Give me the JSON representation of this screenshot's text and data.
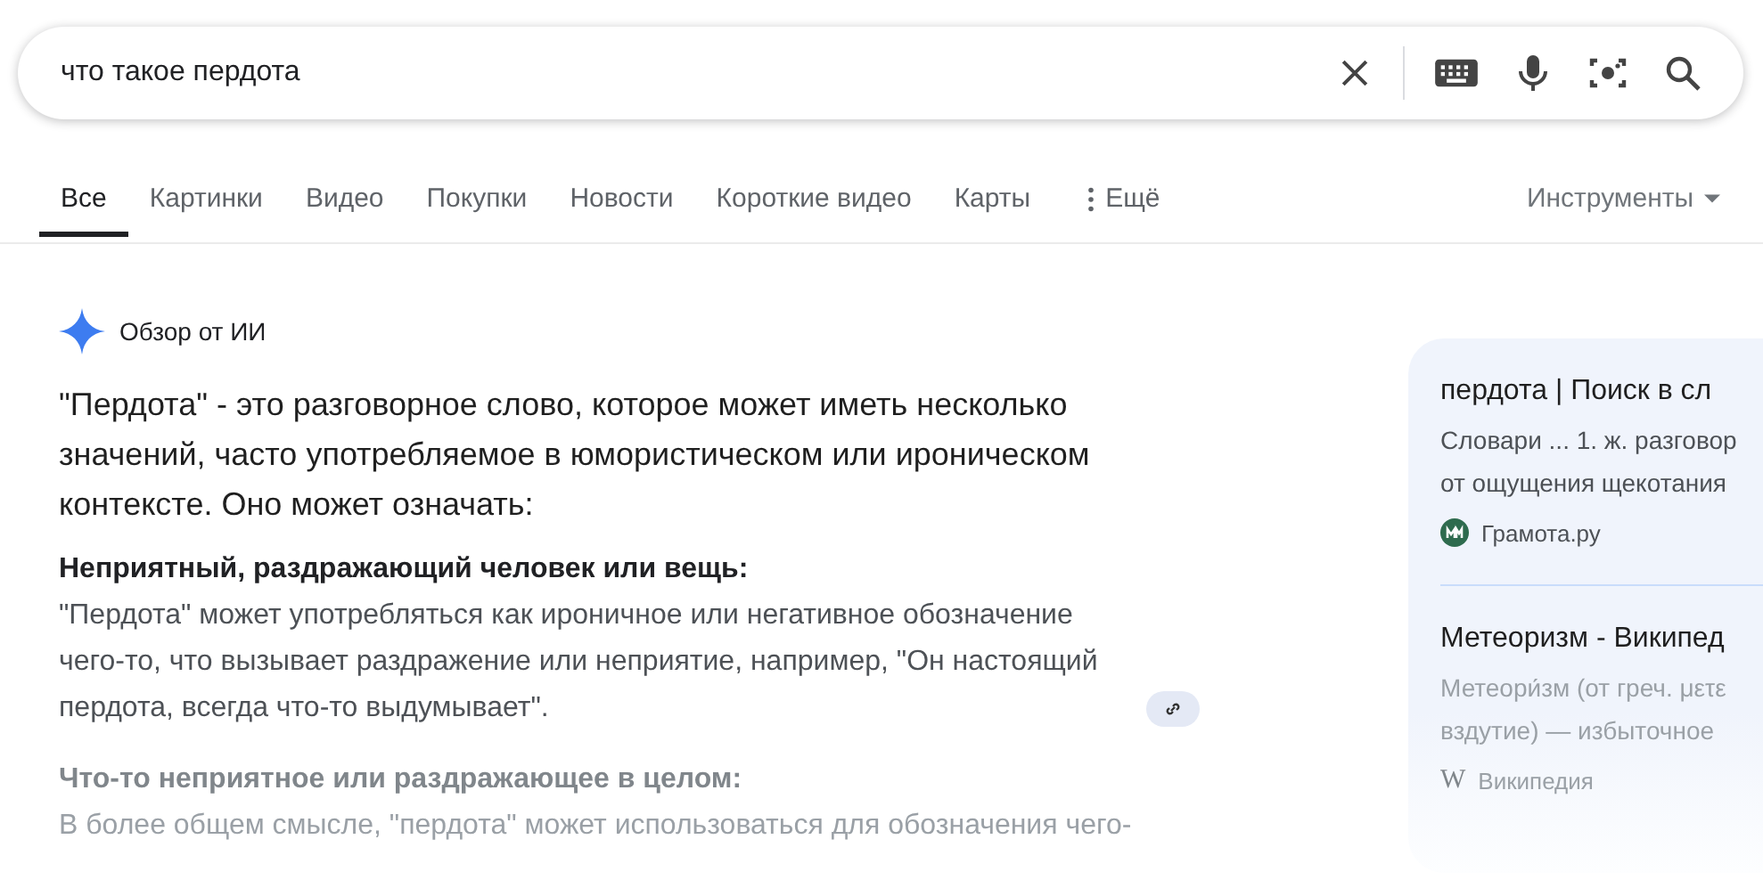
{
  "search": {
    "value": "что такое пердота"
  },
  "tabs": [
    {
      "label": "Все",
      "kind": "tab",
      "selected": true
    },
    {
      "label": "Картинки",
      "kind": "tab",
      "selected": false
    },
    {
      "label": "Видео",
      "kind": "tab",
      "selected": false
    },
    {
      "label": "Покупки",
      "kind": "tab",
      "selected": false
    },
    {
      "label": "Новости",
      "kind": "tab",
      "selected": false
    },
    {
      "label": "Короткие видео",
      "kind": "tab",
      "selected": false
    },
    {
      "label": "Карты",
      "kind": "tab",
      "selected": false
    },
    {
      "label": "Ещё",
      "kind": "more",
      "selected": false
    }
  ],
  "tools": {
    "label": "Инструменты"
  },
  "ai_overview": {
    "title": "Обзор от ИИ",
    "intro": "\"Пердота\" - это разговорное слово, которое может иметь несколько значений, часто употребляемое в юмористическом или ироническом контексте. Оно может означать:",
    "sections": [
      {
        "faded": false,
        "heading": "Неприятный, раздражающий человек или вещь:",
        "text": "\"Пердота\" может употребляться как ироничное или негативное обозначение чего-то, что вызывает раздражение или неприятие, например, \"Он настоящий пердота, всегда что-то выдумывает\".",
        "link": true
      },
      {
        "faded": true,
        "heading": "Что-то неприятное или раздражающее в целом:",
        "text": "В более общем смысле, \"пердота\" может использоваться для обозначения чего-",
        "link": false
      }
    ]
  },
  "sources": [
    {
      "faded": false,
      "kind": "round-logo",
      "title": "пердота | Поиск в сл",
      "snippet": [
        "Словари ... 1. ж. разговор",
        "от ощущения щекотания"
      ],
      "site": "Грамота.ру"
    },
    {
      "faded": true,
      "kind": "letter-logo",
      "title": "Метеоризм - Википед",
      "snippet": [
        "Метеори́зм (от греч. μετε",
        "вздутие) — избыточное"
      ],
      "site": "Википедия",
      "logo_text": "W"
    }
  ]
}
